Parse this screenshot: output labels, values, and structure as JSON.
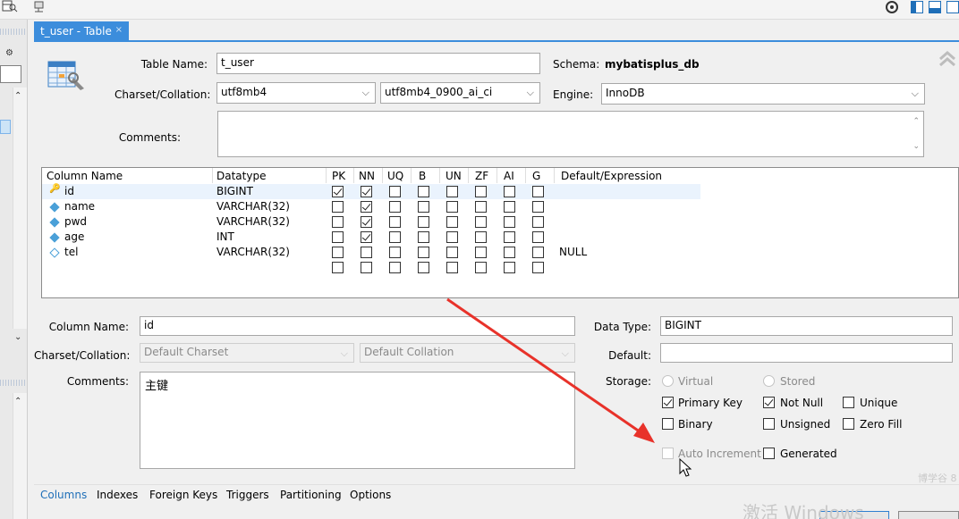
{
  "toolbar": {
    "left_icons": [
      "table-search-icon",
      "plug-icon"
    ],
    "right_icons": [
      "settings-icon",
      "panel-left-icon",
      "panel-bottom-icon",
      "panel-right-icon"
    ]
  },
  "tab": {
    "title": "t_user - Table",
    "close": "×"
  },
  "form": {
    "table_name_label": "Table Name:",
    "table_name": "t_user",
    "schema_label": "Schema:",
    "schema_value": "mybatisplus_db",
    "charset_label": "Charset/Collation:",
    "charset": "utf8mb4",
    "collation": "utf8mb4_0900_ai_ci",
    "engine_label": "Engine:",
    "engine": "InnoDB",
    "comments_label": "Comments:"
  },
  "grid": {
    "headers": [
      "Column Name",
      "Datatype",
      "PK",
      "NN",
      "UQ",
      "B",
      "UN",
      "ZF",
      "AI",
      "G",
      "Default/Expression"
    ],
    "rows": [
      {
        "name": "id",
        "type": "BIGINT",
        "flags": [
          1,
          1,
          0,
          0,
          0,
          0,
          0,
          0
        ],
        "default": "",
        "icon": "key"
      },
      {
        "name": "name",
        "type": "VARCHAR(32)",
        "flags": [
          0,
          1,
          0,
          0,
          0,
          0,
          0,
          0
        ],
        "default": "",
        "icon": "diamond"
      },
      {
        "name": "pwd",
        "type": "VARCHAR(32)",
        "flags": [
          0,
          1,
          0,
          0,
          0,
          0,
          0,
          0
        ],
        "default": "",
        "icon": "diamond"
      },
      {
        "name": "age",
        "type": "INT",
        "flags": [
          0,
          1,
          0,
          0,
          0,
          0,
          0,
          0
        ],
        "default": "",
        "icon": "diamond"
      },
      {
        "name": "tel",
        "type": "VARCHAR(32)",
        "flags": [
          0,
          0,
          0,
          0,
          0,
          0,
          0,
          0
        ],
        "default": "NULL",
        "icon": "diamond-hollow"
      },
      {
        "name": "",
        "type": "",
        "flags": [
          0,
          0,
          0,
          0,
          0,
          0,
          0,
          0
        ],
        "default": "",
        "icon": ""
      }
    ]
  },
  "details": {
    "column_name_label": "Column Name:",
    "column_name": "id",
    "data_type_label": "Data Type:",
    "data_type": "BIGINT",
    "charset_label": "Charset/Collation:",
    "charset_placeholder": "Default Charset",
    "collation_placeholder": "Default Collation",
    "default_label": "Default:",
    "default_value": "",
    "comments_label": "Comments:",
    "comments": "主键",
    "storage_label": "Storage:",
    "virtual": "Virtual",
    "stored": "Stored",
    "primary_key": "Primary Key",
    "not_null": "Not Null",
    "unique": "Unique",
    "binary": "Binary",
    "unsigned": "Unsigned",
    "zero_fill": "Zero Fill",
    "auto_increment": "Auto Increment",
    "generated": "Generated"
  },
  "bottom_tabs": [
    "Columns",
    "Indexes",
    "Foreign Keys",
    "Triggers",
    "Partitioning",
    "Options"
  ],
  "watermark": {
    "main": "激活 Windows",
    "small": "博学谷 8"
  },
  "colors": {
    "accent": "#3c8ddc",
    "arrow": "#e8322a"
  }
}
